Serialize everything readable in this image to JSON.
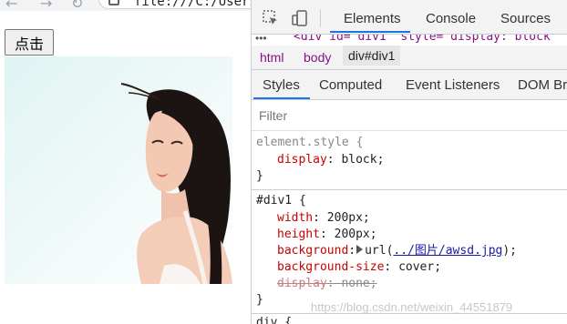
{
  "browser": {
    "address_text": "file:///C:/Users/",
    "back_glyph": "←",
    "forward_glyph": "→",
    "reload_glyph": "↻"
  },
  "page": {
    "button_label": "点击"
  },
  "devtools": {
    "tabs": [
      "Elements",
      "Console",
      "Sources"
    ],
    "active_tab": "Elements",
    "dom_line": {
      "dots": "•••",
      "code": "<div id=\"div1\" style=\"display: block"
    },
    "breadcrumbs": [
      "html",
      "body",
      "div#div1"
    ],
    "subtabs": [
      "Styles",
      "Computed",
      "Event Listeners",
      "DOM Bre"
    ],
    "active_subtab": "Styles",
    "filter_placeholder": "Filter",
    "element_style": {
      "selector": "element.style {",
      "prop": "display",
      "value": "block;",
      "close": "}"
    },
    "div1_rule": {
      "selector": "#div1 {",
      "width": {
        "prop": "width",
        "value": "200px;"
      },
      "height": {
        "prop": "height",
        "value": "200px;"
      },
      "background": {
        "prop": "background",
        "value_prefix": "url(",
        "link": "../图片/awsd.jpg",
        "value_suffix": ");"
      },
      "background_size": {
        "prop": "background-size",
        "value": "cover;"
      },
      "display": {
        "prop": "display",
        "value": "none;"
      },
      "close": "}"
    },
    "next_rule_selector": "div {"
  },
  "watermark": "https://blog.csdn.net/weixin_44551879"
}
